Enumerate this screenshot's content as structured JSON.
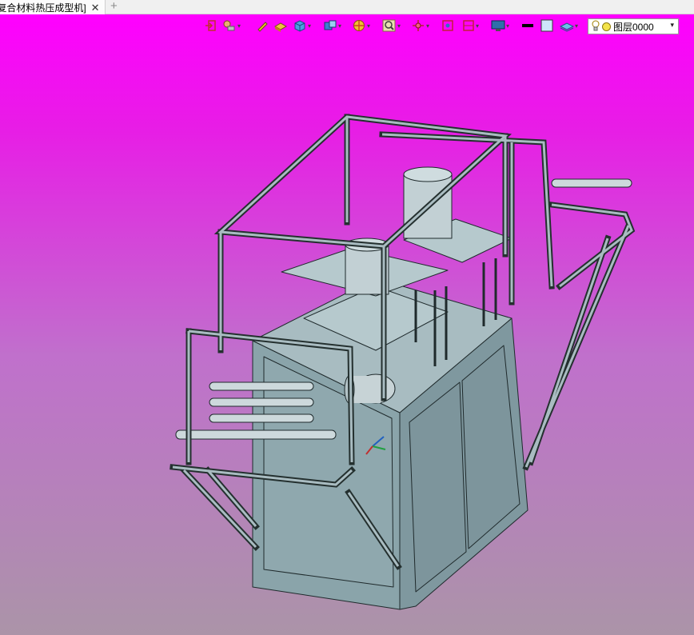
{
  "tab": {
    "title": "[复合材料热压成型机]",
    "close": "✕",
    "add": "+"
  },
  "toolbar": {
    "icons": [
      "exit-sketch-icon",
      "measure-icon",
      "pen-icon",
      "render-style-icon",
      "cube-view-icon",
      "orientation-icon",
      "section-icon",
      "zoom-icon",
      "pan-icon",
      "zoom-fit-icon",
      "frame-icon",
      "display-icon",
      "line-color-icon",
      "fill-color-icon",
      "layer-visibility-icon"
    ],
    "layer": {
      "name": "图层0000",
      "arrow": "▾"
    }
  },
  "colors": {
    "background_top": "#ff00ff",
    "background_bottom": "#ab94a8",
    "model_fill": "#9fb5bc",
    "model_edge": "#1f2a2c",
    "cabinet_fill": "#8aa2a8"
  },
  "model": {
    "description_visible": false
  }
}
